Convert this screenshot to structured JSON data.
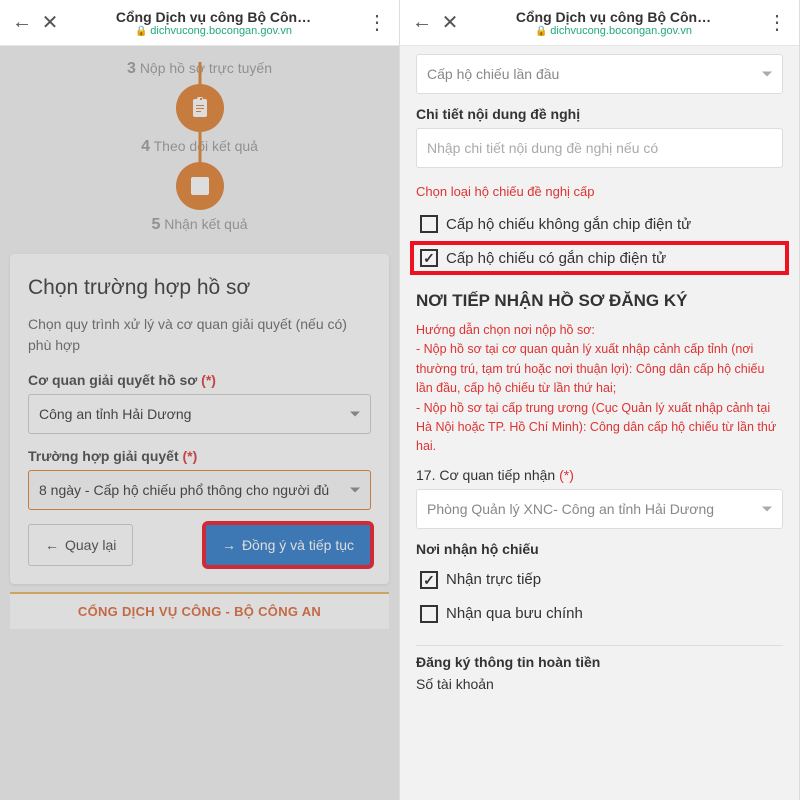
{
  "header": {
    "title": "Cổng Dịch vụ công Bộ Côn…",
    "url": "dichvucong.bocongan.gov.vn"
  },
  "left": {
    "steps": {
      "s3": "Nộp hồ sơ trực tuyến",
      "s4": "Theo dõi kết quả",
      "s5": "Nhận kết quả",
      "n3": "3",
      "n4": "4",
      "n5": "5"
    },
    "card": {
      "heading": "Chọn trường hợp hồ sơ",
      "desc": "Chọn quy trình xử lý và cơ quan giải quyết (nếu có) phù hợp",
      "agency_label": "Cơ quan giải quyết hồ sơ",
      "agency_value": "Công an tỉnh Hải Dương",
      "case_label": "Trường hợp giải quyết",
      "case_value": "8 ngày - Cấp hộ chiếu phổ thông cho người đủ",
      "back": "Quay lại",
      "agree": "Đồng ý và tiếp tục",
      "star": "(*)"
    },
    "footer": "CỔNG DỊCH VỤ CÔNG - BỘ CÔNG AN"
  },
  "right": {
    "top_select": "Cấp hộ chiếu lần đầu",
    "detail_label": "Chi tiết nội dung đề nghị",
    "detail_placeholder": "Nhập chi tiết nội dung đề nghị nếu có",
    "type_label": "Chọn loại hộ chiếu đề nghị cấp",
    "cb_nochip": "Cấp hộ chiếu không gắn chip điện tử",
    "cb_chip": "Cấp hộ chiếu có gắn chip điện tử",
    "section": "NƠI TIẾP NHẬN HỒ SƠ ĐĂNG KÝ",
    "guide_title": "Hướng dẫn chọn nơi nộp hồ sơ:",
    "guide_line1": "- Nộp hồ sơ tại cơ quan quản lý xuất nhập cảnh cấp tỉnh (nơi thường trú, tạm trú hoặc nơi thuận lợi): Công dân cấp hộ chiếu lần đầu, cấp hộ chiếu từ lần thứ hai;",
    "guide_line2": "- Nộp hồ sơ tại cấp trung ương (Cục Quản lý xuất nhập cảnh tại Hà Nội hoặc TP. Hồ Chí Minh): Công dân cấp hộ chiếu từ lần thứ hai.",
    "q17_label": "17. Cơ quan tiếp nhận",
    "q17_value": "Phòng Quản lý XNC- Công an tỉnh Hải Dương",
    "receive_label": "Nơi nhận hộ chiếu",
    "receive_direct": "Nhận trực tiếp",
    "receive_post": "Nhận qua bưu chính",
    "refund_label": "Đăng ký thông tin hoàn tiền",
    "account_label": "Số tài khoản",
    "star": "(*)"
  }
}
